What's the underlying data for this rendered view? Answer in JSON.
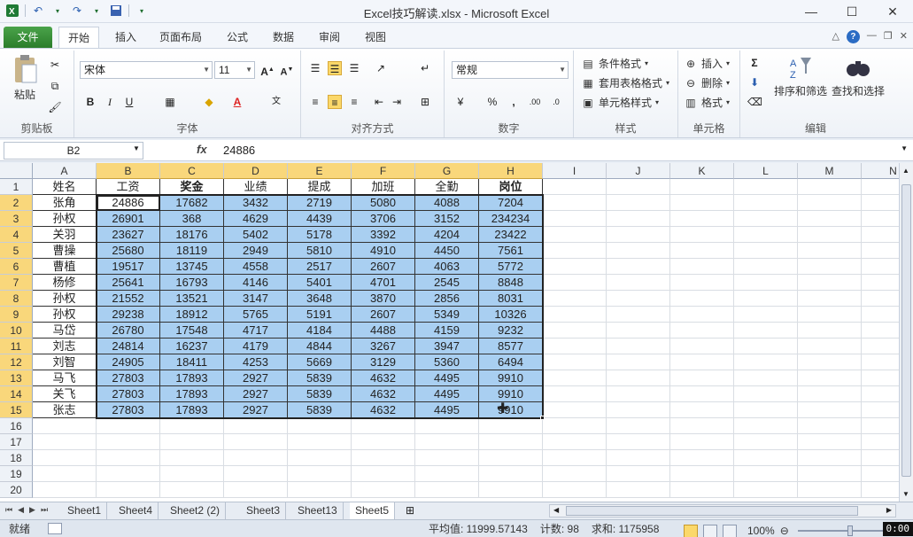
{
  "window": {
    "title": "Excel技巧解读.xlsx  -  Microsoft Excel",
    "min": "—",
    "max": "☐",
    "close": "✕"
  },
  "ribbon_tabs": [
    "文件",
    "开始",
    "插入",
    "页面布局",
    "公式",
    "数据",
    "审阅",
    "视图"
  ],
  "ribbon": {
    "clipboard": {
      "paste": "粘贴",
      "label": "剪贴板"
    },
    "font": {
      "name": "宋体",
      "size": "11",
      "bold": "B",
      "italic": "I",
      "underline": "U",
      "label": "字体"
    },
    "align": {
      "label": "对齐方式"
    },
    "number": {
      "format": "常规",
      "percent": "%",
      "comma": ",",
      "label": "数字"
    },
    "styles": {
      "cond": "条件格式",
      "table": "套用表格格式",
      "cell": "单元格样式",
      "label": "样式"
    },
    "cells": {
      "insert": "插入",
      "delete": "删除",
      "format": "格式",
      "label": "单元格"
    },
    "editing": {
      "sort": "排序和筛选",
      "find": "查找和选择",
      "label": "编辑"
    }
  },
  "formula_bar": {
    "name_box": "B2",
    "fx": "fx",
    "value": "24886"
  },
  "columns": [
    "A",
    "B",
    "C",
    "D",
    "E",
    "F",
    "G",
    "H",
    "I",
    "J",
    "K",
    "L",
    "M",
    "N"
  ],
  "rows": [
    "1",
    "2",
    "3",
    "4",
    "5",
    "6",
    "7",
    "8",
    "9",
    "10",
    "11",
    "12",
    "13",
    "14",
    "15",
    "16",
    "17",
    "18",
    "19",
    "20"
  ],
  "headers": [
    "姓名",
    "工资",
    "奖金",
    "业绩",
    "提成",
    "加班",
    "全勤",
    "岗位"
  ],
  "table": [
    [
      "张角",
      "24886",
      "17682",
      "3432",
      "2719",
      "5080",
      "4088",
      "7204"
    ],
    [
      "孙权",
      "26901",
      "368",
      "4629",
      "4439",
      "3706",
      "3152",
      "234234"
    ],
    [
      "关羽",
      "23627",
      "18176",
      "5402",
      "5178",
      "3392",
      "4204",
      "23422"
    ],
    [
      "曹操",
      "25680",
      "18119",
      "2949",
      "5810",
      "4910",
      "4450",
      "7561"
    ],
    [
      "曹植",
      "19517",
      "13745",
      "4558",
      "2517",
      "2607",
      "4063",
      "5772"
    ],
    [
      "杨修",
      "25641",
      "16793",
      "4146",
      "5401",
      "4701",
      "2545",
      "8848"
    ],
    [
      "孙权",
      "21552",
      "13521",
      "3147",
      "3648",
      "3870",
      "2856",
      "8031"
    ],
    [
      "孙权",
      "29238",
      "18912",
      "5765",
      "5191",
      "2607",
      "5349",
      "10326"
    ],
    [
      "马岱",
      "26780",
      "17548",
      "4717",
      "4184",
      "4488",
      "4159",
      "9232"
    ],
    [
      "刘志",
      "24814",
      "16237",
      "4179",
      "4844",
      "3267",
      "3947",
      "8577"
    ],
    [
      "刘智",
      "24905",
      "18411",
      "4253",
      "5669",
      "3129",
      "5360",
      "6494"
    ],
    [
      "马飞",
      "27803",
      "17893",
      "2927",
      "5839",
      "4632",
      "4495",
      "9910"
    ],
    [
      "关飞",
      "27803",
      "17893",
      "2927",
      "5839",
      "4632",
      "4495",
      "9910"
    ],
    [
      "张志",
      "27803",
      "17893",
      "2927",
      "5839",
      "4632",
      "4495",
      "9910"
    ]
  ],
  "sheet_tabs": [
    "Sheet1",
    "Sheet4",
    "Sheet2 (2)",
    "Sheet3",
    "Sheet13",
    "Sheet5"
  ],
  "active_sheet": "Sheet5",
  "status": {
    "ready": "就绪",
    "average": "平均值: 11999.57143",
    "count": "计数: 98",
    "sum": "求和: 1175958",
    "zoom": "100%",
    "timer": "0:00"
  },
  "colors": {
    "selection": "#a9cff1",
    "header_selected": "#f9d77b",
    "file_tab": "#2b7d2b"
  }
}
